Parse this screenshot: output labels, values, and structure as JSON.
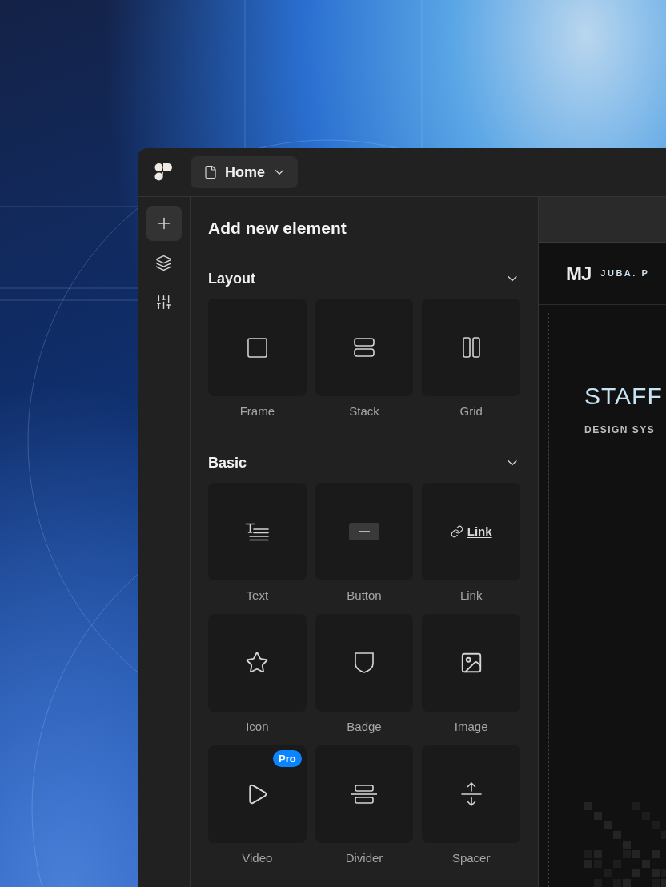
{
  "top_bar": {
    "page_menu": {
      "label": "Home"
    }
  },
  "rail": [
    {
      "kind": "add",
      "selected": true
    },
    {
      "kind": "layers",
      "selected": false
    },
    {
      "kind": "sliders",
      "selected": false
    }
  ],
  "panel": {
    "title": "Add new element",
    "sections": [
      {
        "title": "Layout",
        "expanded": true,
        "items": [
          {
            "kind": "frame",
            "label": "Frame"
          },
          {
            "kind": "stack",
            "label": "Stack"
          },
          {
            "kind": "grid",
            "label": "Grid"
          }
        ]
      },
      {
        "title": "Basic",
        "expanded": true,
        "items": [
          {
            "kind": "text",
            "label": "Text"
          },
          {
            "kind": "button",
            "label": "Button"
          },
          {
            "kind": "link",
            "label": "Link",
            "preview": "Link"
          },
          {
            "kind": "icon",
            "label": "Icon"
          },
          {
            "kind": "badge",
            "label": "Badge"
          },
          {
            "kind": "image",
            "label": "Image"
          },
          {
            "kind": "video",
            "label": "Video",
            "badge": "Pro"
          },
          {
            "kind": "divider",
            "label": "Divider"
          },
          {
            "kind": "spacer",
            "label": "Spacer"
          }
        ]
      }
    ]
  },
  "canvas": {
    "logo": "MJ",
    "brand": "JUBA. P",
    "heading": "STAFF",
    "subheading": "DESIGN SYS"
  }
}
